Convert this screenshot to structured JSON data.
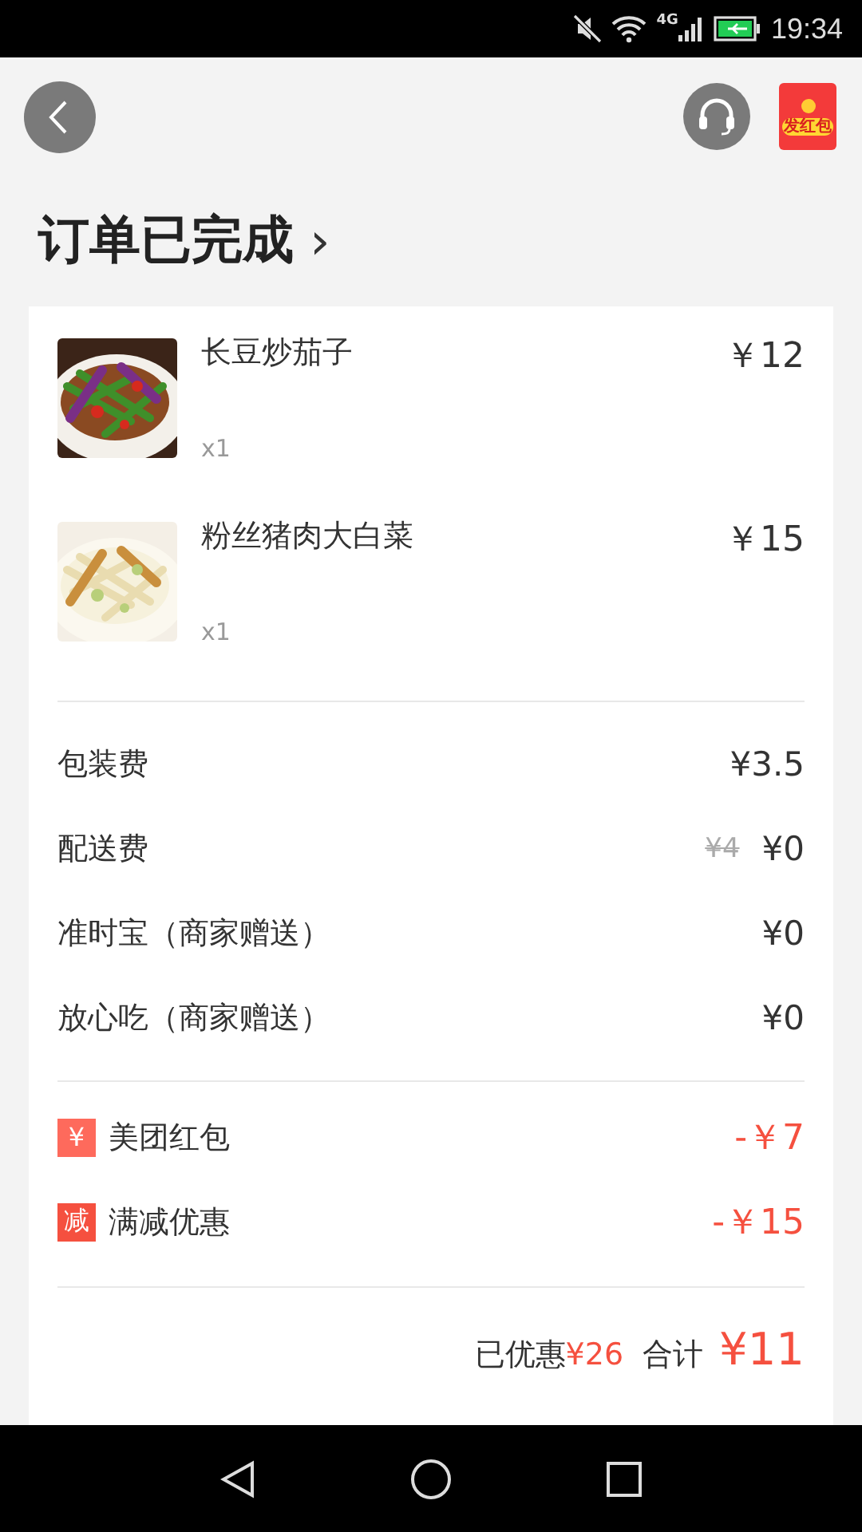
{
  "status_bar": {
    "time": "19:34",
    "network": "4G"
  },
  "header": {
    "red_packet_label": "发红包"
  },
  "title": "订单已完成",
  "title_chevron": "›",
  "items": [
    {
      "name": "长豆炒茄子",
      "quantity": "x1",
      "price": "￥12"
    },
    {
      "name": "粉丝猪肉大白菜",
      "quantity": "x1",
      "price": "￥15"
    }
  ],
  "fees": [
    {
      "label": "包装费",
      "amount": "¥3.5"
    },
    {
      "label": "配送费",
      "original": "¥4",
      "amount": "¥0"
    },
    {
      "label": "准时宝（商家赠送）",
      "amount": "¥0"
    },
    {
      "label": "放心吃（商家赠送）",
      "amount": "¥0"
    }
  ],
  "discounts": [
    {
      "badge": "¥",
      "label": "美团红包",
      "amount": "-￥7",
      "color": "#fe6a5c"
    },
    {
      "badge": "减",
      "label": "满减优惠",
      "amount": "-￥15",
      "color": "#f5503f"
    }
  ],
  "summary": {
    "saved_label": "已优惠",
    "saved_amount": "¥26",
    "total_label": "合计",
    "total_amount": "¥11"
  }
}
